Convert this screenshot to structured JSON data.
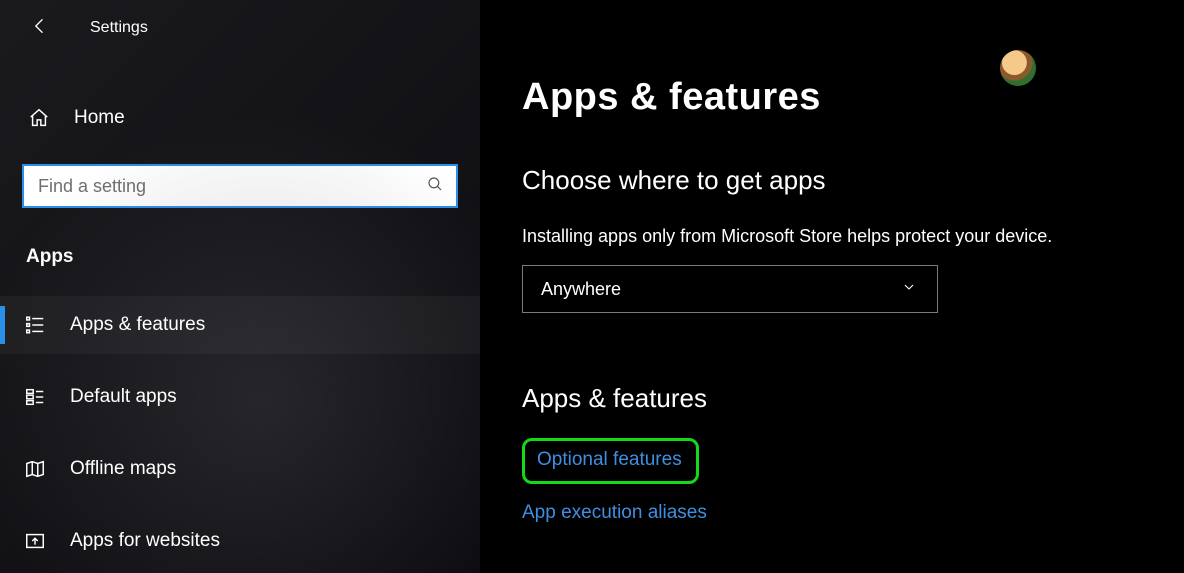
{
  "header": {
    "title": "Settings"
  },
  "sidebar": {
    "home_label": "Home",
    "search_placeholder": "Find a setting",
    "section_label": "Apps",
    "items": [
      {
        "label": "Apps & features",
        "active": true
      },
      {
        "label": "Default apps",
        "active": false
      },
      {
        "label": "Offline maps",
        "active": false
      },
      {
        "label": "Apps for websites",
        "active": false
      }
    ]
  },
  "main": {
    "page_title": "Apps & features",
    "choose_heading": "Choose where to get apps",
    "choose_help": "Installing apps only from Microsoft Store helps protect your device.",
    "source_dropdown": {
      "value": "Anywhere"
    },
    "apps_features_heading": "Apps & features",
    "links": {
      "optional_features": "Optional features",
      "app_execution_aliases": "App execution aliases"
    }
  },
  "icons": {
    "back": "back-arrow-icon",
    "home": "home-icon",
    "search": "search-icon",
    "apps_features": "list-icon",
    "default_apps": "default-apps-icon",
    "offline_maps": "map-icon",
    "apps_for_websites": "open-in-app-icon",
    "chevron_down": "chevron-down-icon",
    "avatar": "user-avatar-icon"
  },
  "colors": {
    "accent": "#2a8fe8",
    "link": "#3f8fe0",
    "highlight_border": "#14d81a"
  }
}
